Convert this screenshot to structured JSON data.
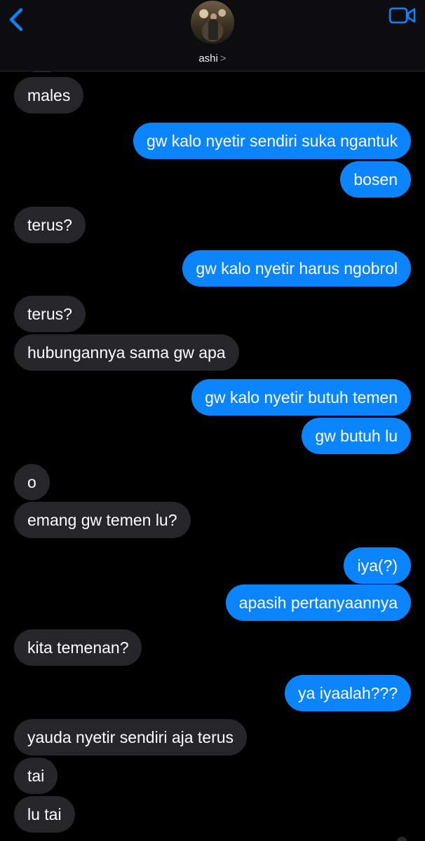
{
  "header": {
    "contact_name": "ashi",
    "chevron": ">",
    "back_icon": "chevron-left-icon",
    "video_icon": "video-camera-icon",
    "accent": "#0a84ff"
  },
  "messages": [
    {
      "side": "in",
      "text": "males"
    },
    {
      "side": "out",
      "text": "gw kalo nyetir sendiri suka ngantuk"
    },
    {
      "side": "out",
      "text": "bosen"
    },
    {
      "side": "in",
      "text": "terus?"
    },
    {
      "side": "out",
      "text": "gw kalo nyetir harus ngobrol"
    },
    {
      "side": "in",
      "text": "terus?"
    },
    {
      "side": "in",
      "text": "hubungannya sama gw apa"
    },
    {
      "side": "out",
      "text": "gw kalo nyetir butuh temen"
    },
    {
      "side": "out",
      "text": "gw butuh lu"
    },
    {
      "side": "in",
      "text": "o"
    },
    {
      "side": "in",
      "text": "emang gw temen lu?"
    },
    {
      "side": "out",
      "text": "iya(?)"
    },
    {
      "side": "out",
      "text": "apasih pertanyaannya"
    },
    {
      "side": "in",
      "text": "kita temenan?"
    },
    {
      "side": "out",
      "text": "ya iyaalah???"
    },
    {
      "side": "in",
      "text": "yauda nyetir sendiri aja terus"
    },
    {
      "side": "in",
      "text": "tai"
    },
    {
      "side": "in",
      "text": "lu tai"
    }
  ]
}
